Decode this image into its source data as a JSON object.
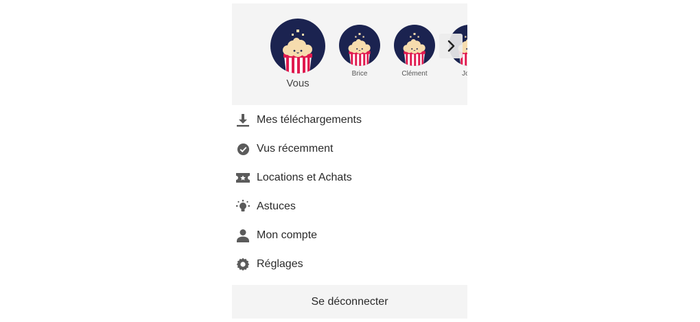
{
  "profiles": [
    {
      "name": "Vous"
    },
    {
      "name": "Brice"
    },
    {
      "name": "Clément"
    },
    {
      "name": "Jona"
    }
  ],
  "menu": [
    {
      "label": "Mes téléchargements",
      "icon": "download-icon"
    },
    {
      "label": "Vus récemment",
      "icon": "check-circle-icon"
    },
    {
      "label": "Locations et Achats",
      "icon": "ticket-icon"
    },
    {
      "label": "Astuces",
      "icon": "lightbulb-icon"
    },
    {
      "label": "Mon compte",
      "icon": "person-icon"
    },
    {
      "label": "Réglages",
      "icon": "gear-icon"
    }
  ],
  "logout_label": "Se déconnecter",
  "colors": {
    "avatar_bg": "#1b2350",
    "popcorn": "#f6dcae",
    "box_red": "#e01a4f",
    "icon_gray": "#5b5b5b",
    "panel_gray": "#f4f4f4"
  }
}
